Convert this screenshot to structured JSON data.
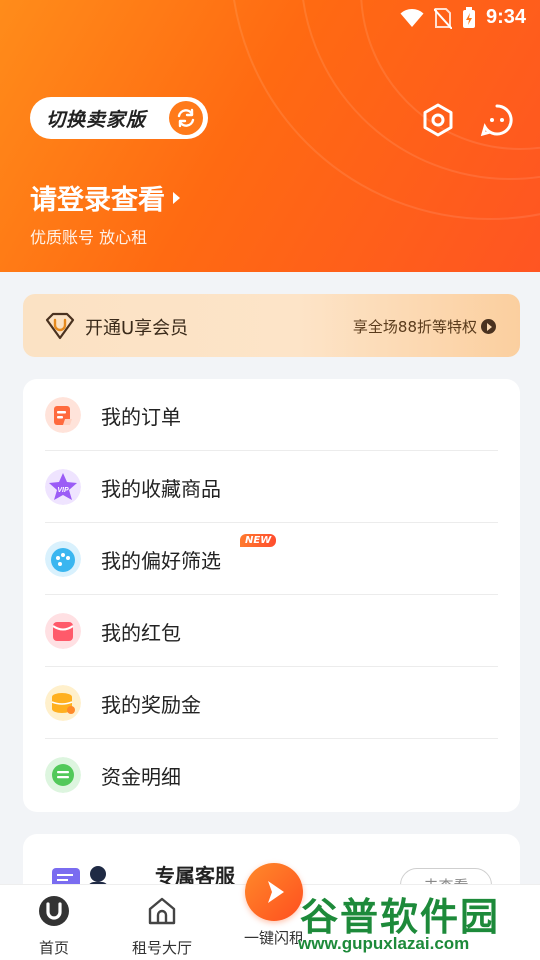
{
  "status_bar": {
    "time": "9:34"
  },
  "header": {
    "switch_label": "切换卖家版",
    "login_title": "请登录查看",
    "login_subtitle": "优质账号 放心租"
  },
  "vip_banner": {
    "label": "开通U享会员",
    "right_text": "享全场88折等特权"
  },
  "menu": {
    "items": [
      {
        "label": "我的订单",
        "icon": "order-icon",
        "color": "#ff6a3d"
      },
      {
        "label": "我的收藏商品",
        "icon": "vip-star-icon",
        "color": "#9b5cf6"
      },
      {
        "label": "我的偏好筛选",
        "icon": "palette-icon",
        "color": "#3ab6f0",
        "badge": "NEW"
      },
      {
        "label": "我的红包",
        "icon": "red-packet-icon",
        "color": "#ff5a6a"
      },
      {
        "label": "我的奖励金",
        "icon": "coins-icon",
        "color": "#ffb020"
      },
      {
        "label": "资金明细",
        "icon": "fund-detail-icon",
        "color": "#52c95a"
      }
    ]
  },
  "service_card": {
    "title": "专属客服",
    "button_label": "去查看"
  },
  "bottom_nav": {
    "items": [
      {
        "label": "首页",
        "icon": "home-u-icon"
      },
      {
        "label": "租号大厅",
        "icon": "hall-icon"
      },
      {
        "label": "一键闪租",
        "icon": "flash-icon"
      }
    ]
  },
  "watermark": {
    "title": "谷普软件园",
    "url": "www.gupuxlazai.com"
  },
  "colors": {
    "brand_orange": "#ff6a12",
    "page_bg": "#f2f4f7",
    "watermark_green": "#1d8a3a"
  }
}
